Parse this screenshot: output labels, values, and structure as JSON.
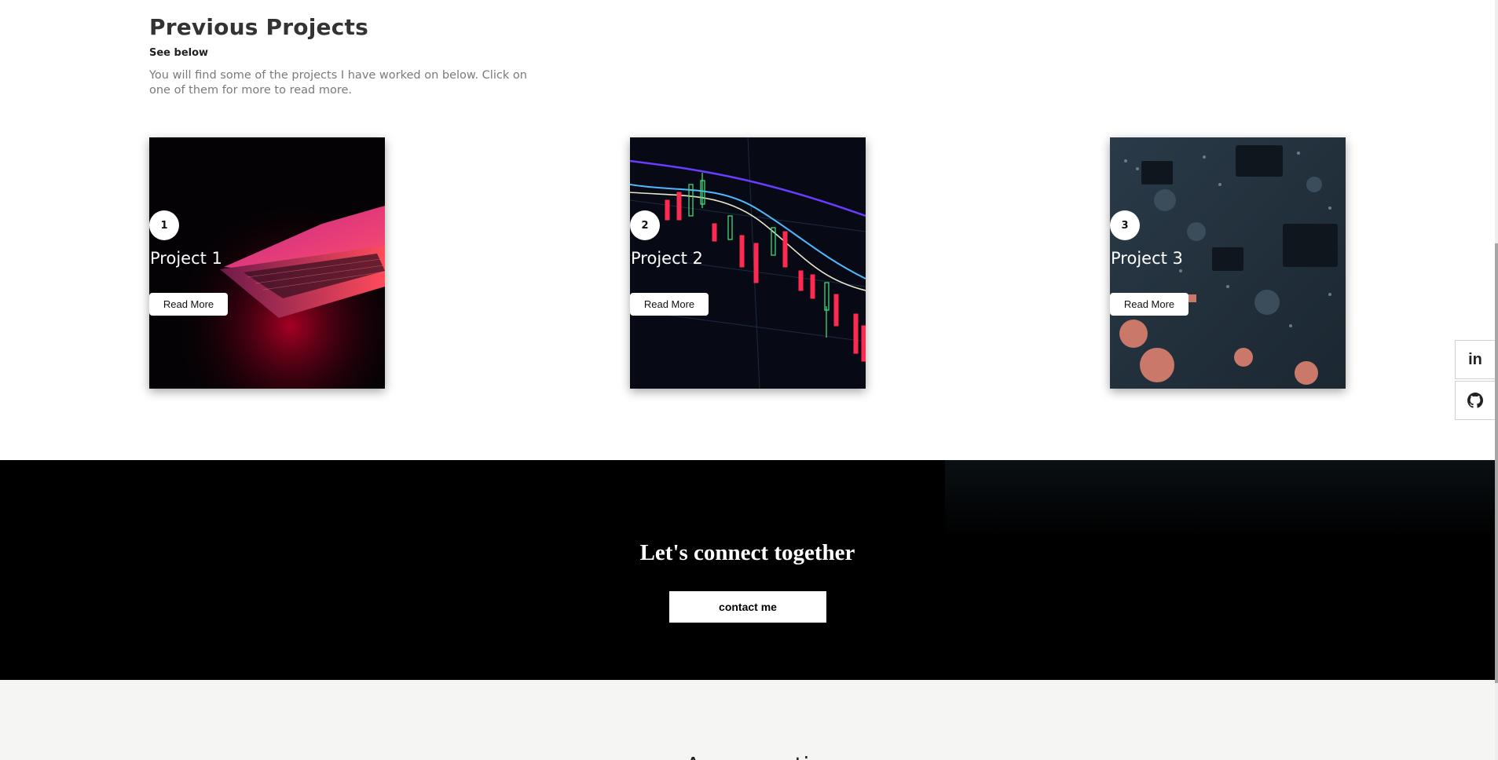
{
  "projects_section": {
    "title": "Previous Projects",
    "subtitle": "See below",
    "description": "You will find some of the projects I have worked on below. Click on one of them for more to read more."
  },
  "projects": [
    {
      "number": "1",
      "title": "Project 1",
      "button_label": "Read More"
    },
    {
      "number": "2",
      "title": "Project 2",
      "button_label": "Read More"
    },
    {
      "number": "3",
      "title": "Project 3",
      "button_label": "Read More"
    }
  ],
  "social": [
    {
      "name": "linkedin",
      "label": "in",
      "icon": "linkedin-icon"
    },
    {
      "name": "github",
      "icon": "github-icon"
    }
  ],
  "connect": {
    "title": "Let's connect together",
    "button_label": "contact me"
  },
  "next_section": {
    "partial_title": "A __ __ __ ti"
  },
  "colors": {
    "banner_bg": "#000000",
    "next_section_bg": "#f5f5f3",
    "accent_red": "#ff2a4f"
  }
}
